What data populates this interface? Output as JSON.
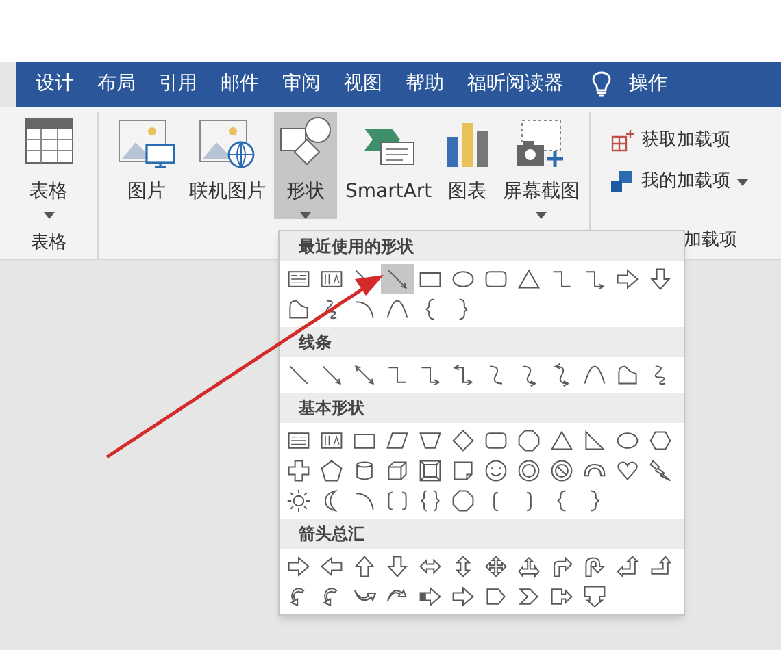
{
  "tabs": [
    {
      "label": "设计",
      "selected": false
    },
    {
      "label": "布局",
      "selected": false
    },
    {
      "label": "引用",
      "selected": false
    },
    {
      "label": "邮件",
      "selected": false
    },
    {
      "label": "审阅",
      "selected": false
    },
    {
      "label": "视图",
      "selected": false
    },
    {
      "label": "帮助",
      "selected": false
    },
    {
      "label": "福昕阅读器",
      "selected": false
    }
  ],
  "tell_me": "操作",
  "ribbon": {
    "groups": [
      {
        "label": "表格",
        "buttons": [
          {
            "kind": "table",
            "label": "表格",
            "dropdown": true,
            "pressed": false
          }
        ]
      },
      {
        "buttons": [
          {
            "kind": "picture",
            "label": "图片",
            "dropdown": false,
            "pressed": false
          },
          {
            "kind": "online-picture",
            "label": "联机图片",
            "dropdown": false,
            "pressed": false
          },
          {
            "kind": "shapes",
            "label": "形状",
            "dropdown": true,
            "pressed": true
          },
          {
            "kind": "smartart",
            "label": "SmartArt",
            "dropdown": false,
            "pressed": false
          },
          {
            "kind": "chart",
            "label": "图表",
            "dropdown": false,
            "pressed": false
          },
          {
            "kind": "screenshot",
            "label": "屏幕截图",
            "dropdown": true,
            "pressed": false
          }
        ]
      },
      {
        "label": "加载项",
        "small_buttons": [
          {
            "kind": "store",
            "label": "获取加载项",
            "dropdown": false
          },
          {
            "kind": "addins",
            "label": "我的加载项",
            "dropdown": true
          }
        ]
      }
    ]
  },
  "shapes_menu": {
    "sections": [
      {
        "title": "最近使用的形状",
        "rows": [
          [
            {
              "kind": "textbox",
              "selected": false
            },
            {
              "kind": "vtextbox",
              "selected": false
            },
            {
              "kind": "line",
              "selected": false
            },
            {
              "kind": "arrow-line",
              "selected": true
            },
            {
              "kind": "rect",
              "selected": false
            },
            {
              "kind": "oval",
              "selected": false
            },
            {
              "kind": "roundrect",
              "selected": false
            },
            {
              "kind": "triangle",
              "selected": false
            },
            {
              "kind": "elbow",
              "selected": false
            },
            {
              "kind": "elbow-arrow",
              "selected": false
            },
            {
              "kind": "right-arrow",
              "selected": false
            },
            {
              "kind": "down-arrow",
              "selected": false
            }
          ],
          [
            {
              "kind": "freeform",
              "selected": false
            },
            {
              "kind": "scribble",
              "selected": false
            },
            {
              "kind": "arc",
              "selected": false
            },
            {
              "kind": "curve",
              "selected": false
            },
            {
              "kind": "left-brace",
              "selected": false
            },
            {
              "kind": "right-brace",
              "selected": false
            }
          ]
        ]
      },
      {
        "title": "线条",
        "rows": [
          [
            {
              "kind": "line",
              "selected": false
            },
            {
              "kind": "arrow-line",
              "selected": false
            },
            {
              "kind": "double-arrow-line",
              "selected": false
            },
            {
              "kind": "elbow",
              "selected": false
            },
            {
              "kind": "elbow-arrow",
              "selected": false
            },
            {
              "kind": "elbow-double",
              "selected": false
            },
            {
              "kind": "curved-connector",
              "selected": false
            },
            {
              "kind": "curved-arrow",
              "selected": false
            },
            {
              "kind": "curved-double",
              "selected": false
            },
            {
              "kind": "curve",
              "selected": false
            },
            {
              "kind": "freeform",
              "selected": false
            },
            {
              "kind": "scribble",
              "selected": false
            }
          ]
        ]
      },
      {
        "title": "基本形状",
        "rows": [
          [
            {
              "kind": "textbox",
              "selected": false
            },
            {
              "kind": "vtextbox",
              "selected": false
            },
            {
              "kind": "rect",
              "selected": false
            },
            {
              "kind": "parallelogram",
              "selected": false
            },
            {
              "kind": "trapezoid",
              "selected": false
            },
            {
              "kind": "diamond",
              "selected": false
            },
            {
              "kind": "roundrect",
              "selected": false
            },
            {
              "kind": "octagon",
              "selected": false
            },
            {
              "kind": "triangle",
              "selected": false
            },
            {
              "kind": "right-triangle",
              "selected": false
            },
            {
              "kind": "oval",
              "selected": false
            },
            {
              "kind": "hexagon",
              "selected": false
            }
          ],
          [
            {
              "kind": "cross",
              "selected": false
            },
            {
              "kind": "pentagon",
              "selected": false
            },
            {
              "kind": "can",
              "selected": false
            },
            {
              "kind": "cube",
              "selected": false
            },
            {
              "kind": "bevel",
              "selected": false
            },
            {
              "kind": "folded",
              "selected": false
            },
            {
              "kind": "smiley",
              "selected": false
            },
            {
              "kind": "donut",
              "selected": false
            },
            {
              "kind": "no-symbol",
              "selected": false
            },
            {
              "kind": "block-arc",
              "selected": false
            },
            {
              "kind": "heart",
              "selected": false
            },
            {
              "kind": "lightning",
              "selected": false
            }
          ],
          [
            {
              "kind": "sun",
              "selected": false
            },
            {
              "kind": "moon",
              "selected": false
            },
            {
              "kind": "arc",
              "selected": false
            },
            {
              "kind": "bracket-pair",
              "selected": false
            },
            {
              "kind": "brace-pair",
              "selected": false
            },
            {
              "kind": "octagon",
              "selected": false
            },
            {
              "kind": "left-bracket",
              "selected": false
            },
            {
              "kind": "right-bracket",
              "selected": false
            },
            {
              "kind": "left-brace",
              "selected": false
            },
            {
              "kind": "right-brace",
              "selected": false
            }
          ]
        ]
      },
      {
        "title": "箭头总汇",
        "rows": [
          [
            {
              "kind": "right-arrow",
              "selected": false
            },
            {
              "kind": "left-arrow",
              "selected": false
            },
            {
              "kind": "up-arrow",
              "selected": false
            },
            {
              "kind": "down-arrow",
              "selected": false
            },
            {
              "kind": "left-right-arrow",
              "selected": false
            },
            {
              "kind": "up-down-arrow",
              "selected": false
            },
            {
              "kind": "quad-arrow",
              "selected": false
            },
            {
              "kind": "left-right-up-arrow",
              "selected": false
            },
            {
              "kind": "bent-arrow",
              "selected": false
            },
            {
              "kind": "u-turn-arrow",
              "selected": false
            },
            {
              "kind": "left-up-arrow",
              "selected": false
            },
            {
              "kind": "bent-up-arrow",
              "selected": false
            }
          ],
          [
            {
              "kind": "circular-arrow",
              "selected": false
            },
            {
              "kind": "circular-arrow",
              "selected": false
            },
            {
              "kind": "curved-up-arrow",
              "selected": false
            },
            {
              "kind": "curved-down-arrow",
              "selected": false
            },
            {
              "kind": "striped-arrow",
              "selected": false
            },
            {
              "kind": "right-arrow",
              "selected": false
            },
            {
              "kind": "pentagon-arrow",
              "selected": false
            },
            {
              "kind": "chevron",
              "selected": false
            },
            {
              "kind": "right-callout",
              "selected": false
            },
            {
              "kind": "down-callout",
              "selected": false
            }
          ]
        ]
      }
    ]
  }
}
